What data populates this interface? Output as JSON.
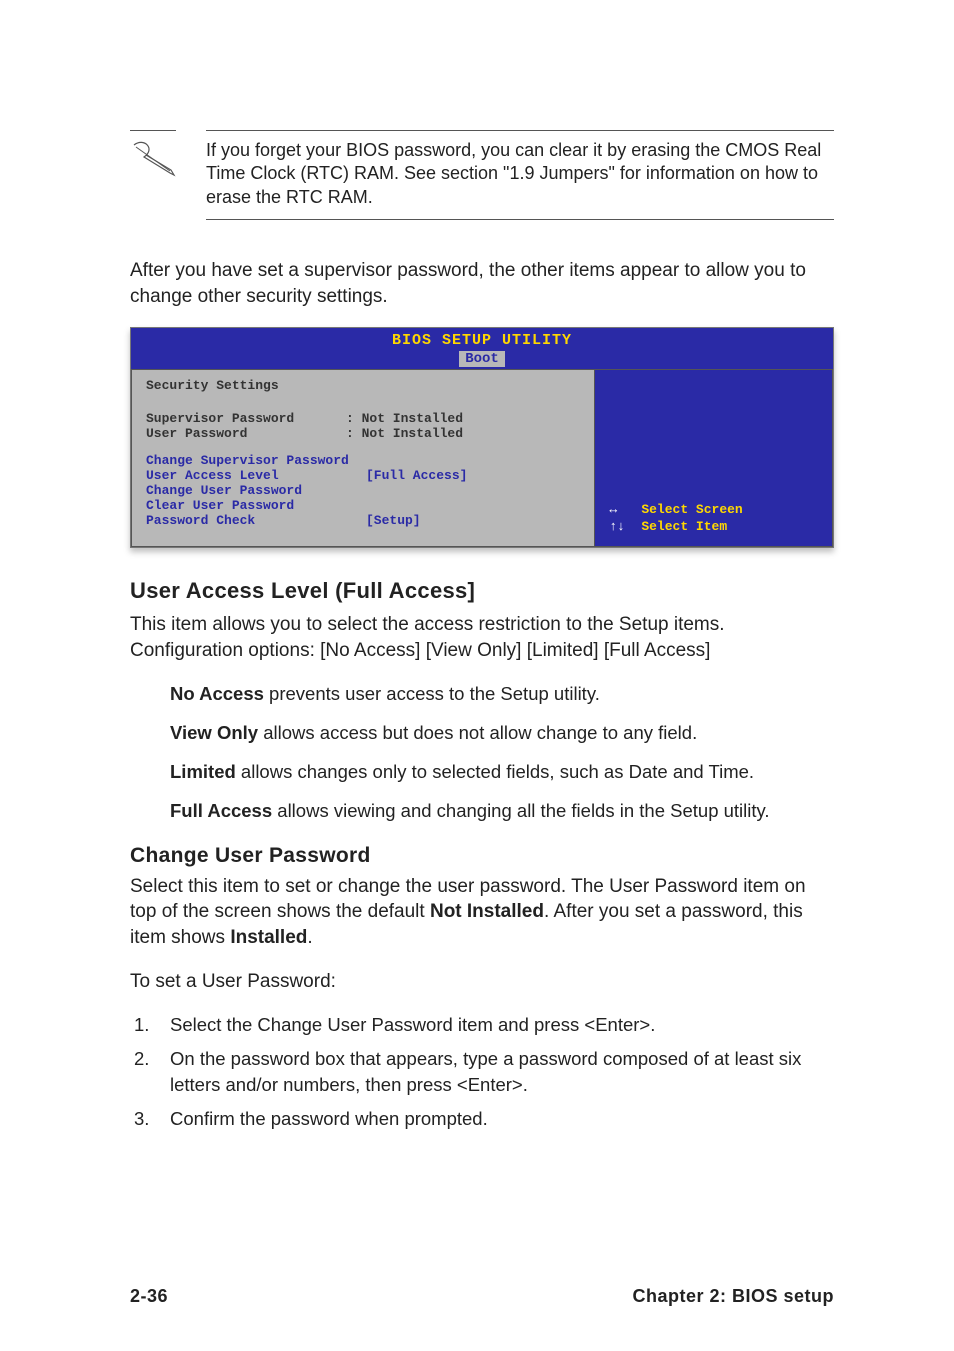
{
  "note": {
    "text": "If you forget your BIOS password, you can clear it by erasing the CMOS Real Time Clock (RTC) RAM. See section \"1.9  Jumpers\" for information on how to erase the RTC RAM."
  },
  "intro": "After you have set a supervisor password, the other items appear to allow you to change other security settings.",
  "bios": {
    "title": "BIOS SETUP UTILITY",
    "tab": "Boot",
    "section_title": "Security Settings",
    "status": [
      {
        "label": "Supervisor Password",
        "value": ": Not Installed"
      },
      {
        "label": "User Password",
        "value": ": Not Installed"
      }
    ],
    "menu": [
      {
        "label": "Change Supervisor Password",
        "value": ""
      },
      {
        "label": "User Access Level",
        "value": "[Full Access]"
      },
      {
        "label": "Change User Password",
        "value": ""
      },
      {
        "label": "Clear User Password",
        "value": ""
      },
      {
        "label": "Password Check",
        "value": "[Setup]"
      }
    ],
    "help": [
      {
        "arrow": "↔",
        "text": "Select Screen"
      },
      {
        "arrow": "↑↓",
        "text": "Select Item"
      }
    ]
  },
  "section1": {
    "heading": "User Access Level (Full Access]",
    "desc": "This item allows you to select the access restriction to the Setup items. Configuration options: [No Access] [View Only] [Limited] [Full Access]",
    "options": [
      {
        "name": "No Access",
        "desc": " prevents user access to the Setup utility."
      },
      {
        "name": "View Only",
        "desc": " allows access but does not allow change to any field."
      },
      {
        "name": "Limited",
        "desc": " allows changes only to selected fields, such as Date and Time."
      },
      {
        "name": "Full Access",
        "desc": " allows viewing and changing all the fields in the Setup utility."
      }
    ]
  },
  "section2": {
    "heading": "Change User Password",
    "desc_pre": "Select this item to set or change the user password. The User Password item on top of the screen shows the default ",
    "desc_b1": "Not Installed",
    "desc_mid": ". After you set a password, this item shows ",
    "desc_b2": "Installed",
    "desc_post": ".",
    "sub": "To set a User Password:",
    "steps": [
      "Select the Change User Password item and press <Enter>.",
      "On the password box that appears, type a password composed of at least six letters and/or numbers, then press <Enter>.",
      "Confirm the password when prompted."
    ]
  },
  "footer": {
    "left": "2-36",
    "right": "Chapter 2: BIOS setup"
  }
}
